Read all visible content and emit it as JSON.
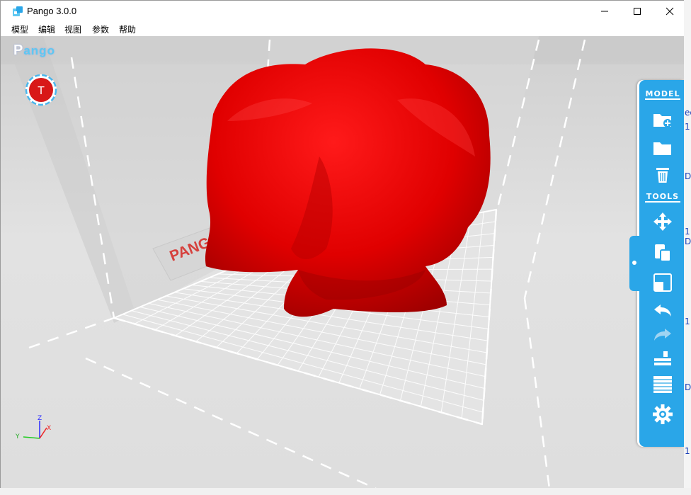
{
  "window": {
    "title": "Pango 3.0.0",
    "controls": {
      "minimize": "—",
      "maximize": "☐",
      "close": "✕"
    }
  },
  "menu": [
    {
      "label": "模型"
    },
    {
      "label": "编辑"
    },
    {
      "label": "视图"
    },
    {
      "label": "参数"
    },
    {
      "label": "帮助"
    }
  ],
  "viewport": {
    "logo_p": "P",
    "logo_rest": "ango",
    "view_button_label": "T",
    "bed_brand": "PANGO",
    "model_color": "#e00000"
  },
  "toolbar": {
    "accent": "#2aa6e8",
    "model_section": "MODEL",
    "tools_section": "TOOLS",
    "model_buttons": [
      {
        "name": "add-model",
        "icon": "folder-plus-icon"
      },
      {
        "name": "open-model",
        "icon": "folder-icon"
      },
      {
        "name": "delete-model",
        "icon": "trash-icon"
      }
    ],
    "tool_buttons": [
      {
        "name": "move",
        "icon": "move-arrows-icon"
      },
      {
        "name": "copy",
        "icon": "copy-icon"
      },
      {
        "name": "scale",
        "icon": "scale-icon"
      },
      {
        "name": "undo",
        "icon": "undo-arrow-icon"
      },
      {
        "name": "redo",
        "icon": "redo-arrow-icon",
        "disabled": true
      },
      {
        "name": "print",
        "icon": "printer-icon"
      },
      {
        "name": "slice",
        "icon": "slice-layers-icon"
      },
      {
        "name": "settings",
        "icon": "gear-icon"
      }
    ]
  },
  "axes": {
    "x": "X",
    "y": "Y",
    "z": "Z"
  },
  "background_fragments": [
    "ec",
    "1",
    "D",
    "1",
    "D",
    "1",
    "D",
    "1"
  ]
}
